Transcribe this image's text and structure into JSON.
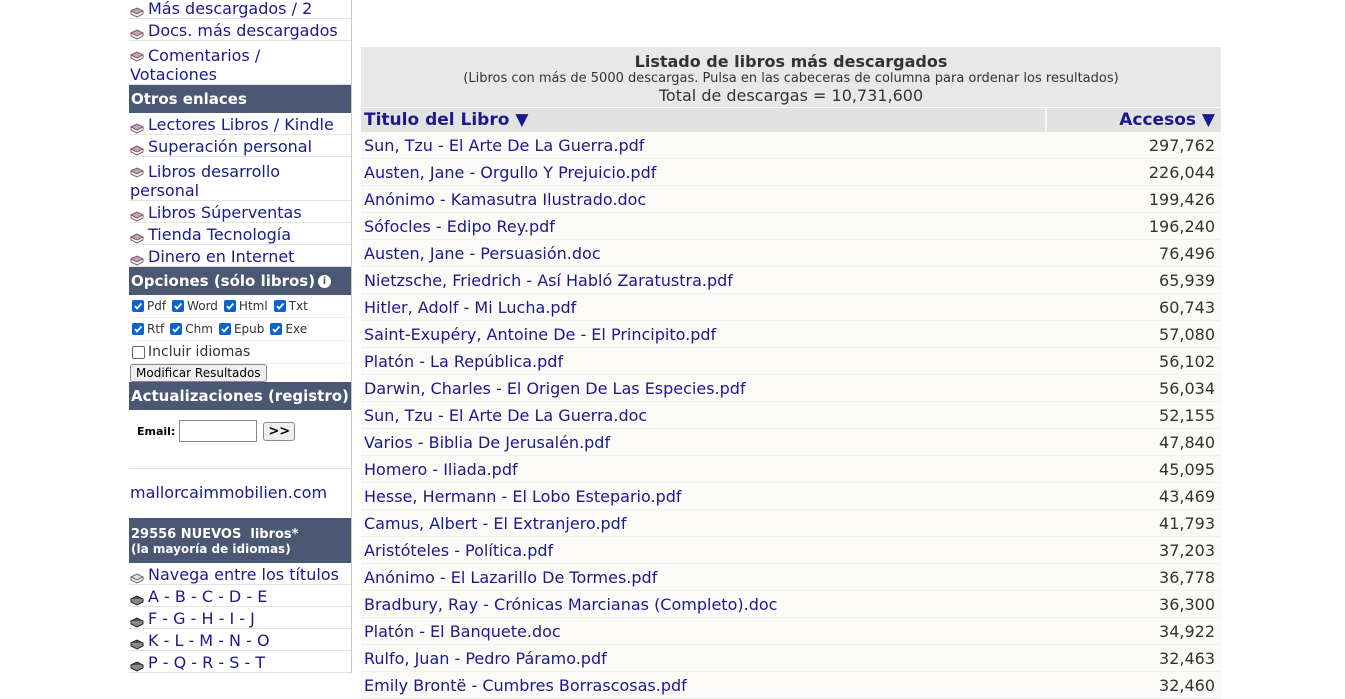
{
  "sidebar": {
    "top_links": [
      "Más descargados / 2",
      "Docs. más descargados",
      "Comentarios / Votaciones"
    ],
    "otros_title": "Otros enlaces",
    "otros_links": [
      "Lectores Libros / Kindle",
      "Superación personal",
      "Libros desarrollo personal",
      "Libros Súperventas",
      "Tienda Tecnología",
      "Dinero en Internet"
    ],
    "opciones_title": "Opciones (sólo libros)",
    "formats_row1": [
      "Pdf",
      "Word",
      "Html",
      "Txt"
    ],
    "formats_row2": [
      "Rtf",
      "Chm",
      "Epub",
      "Exe"
    ],
    "incluir_idiomas": "Incluir idiomas",
    "modificar_btn": "Modificar Resultados",
    "actualizaciones_title": "Actualizaciones (registro)",
    "email_label": "Email:",
    "email_btn": ">>",
    "domain_link": "mallorcaimmobilien.com",
    "nuevos_title": "29556 NUEVOS  libros*",
    "nuevos_sub": "(la mayoría de idiomas)",
    "bottom_links": [
      "Navega entre los títulos",
      "A - B - C - D - E",
      "F - G - H - I - J",
      "K - L - M - N - O",
      "P - Q - R - S - T"
    ]
  },
  "main": {
    "title": "Listado de libros más descargados",
    "subtitle": "(Libros con más de 5000 descargas. Pulsa en las cabeceras de columna para ordenar los resultados)",
    "total": "Total de descargas = 10,731,600",
    "col_title": "Titulo del Libro ▼",
    "col_accesos": "Accesos ▼",
    "rows": [
      {
        "title": "Sun, Tzu - El Arte De La Guerra.pdf",
        "count": "297,762"
      },
      {
        "title": "Austen, Jane - Orgullo Y Prejuicio.pdf",
        "count": "226,044"
      },
      {
        "title": "Anónimo - Kamasutra Ilustrado.doc",
        "count": "199,426"
      },
      {
        "title": "Sófocles - Edipo Rey.pdf",
        "count": "196,240"
      },
      {
        "title": "Austen, Jane - Persuasión.doc",
        "count": "76,496"
      },
      {
        "title": "Nietzsche, Friedrich - Así Habló Zaratustra.pdf",
        "count": "65,939"
      },
      {
        "title": "Hitler, Adolf - Mi Lucha.pdf",
        "count": "60,743"
      },
      {
        "title": "Saint-Exupéry, Antoine De - El Principito.pdf",
        "count": "57,080"
      },
      {
        "title": "Platón - La República.pdf",
        "count": "56,102"
      },
      {
        "title": "Darwin, Charles - El Origen De Las Especies.pdf",
        "count": "56,034"
      },
      {
        "title": "Sun, Tzu - El Arte De La Guerra.doc",
        "count": "52,155"
      },
      {
        "title": "Varios - Biblia De Jerusalén.pdf",
        "count": "47,840"
      },
      {
        "title": "Homero - Iliada.pdf",
        "count": "45,095"
      },
      {
        "title": "Hesse, Hermann - El Lobo Estepario.pdf",
        "count": "43,469"
      },
      {
        "title": "Camus, Albert - El Extranjero.pdf",
        "count": "41,793"
      },
      {
        "title": "Aristóteles - Política.pdf",
        "count": "37,203"
      },
      {
        "title": "Anónimo - El Lazarillo De Tormes.pdf",
        "count": "36,778"
      },
      {
        "title": "Bradbury, Ray - Crónicas Marcianas (Completo).doc",
        "count": "36,300"
      },
      {
        "title": "Platón - El Banquete.doc",
        "count": "34,922"
      },
      {
        "title": "Rulfo, Juan - Pedro Páramo.pdf",
        "count": "32,463"
      },
      {
        "title": "Emily Brontë - Cumbres Borrascosas.pdf",
        "count": "32,460"
      }
    ]
  }
}
